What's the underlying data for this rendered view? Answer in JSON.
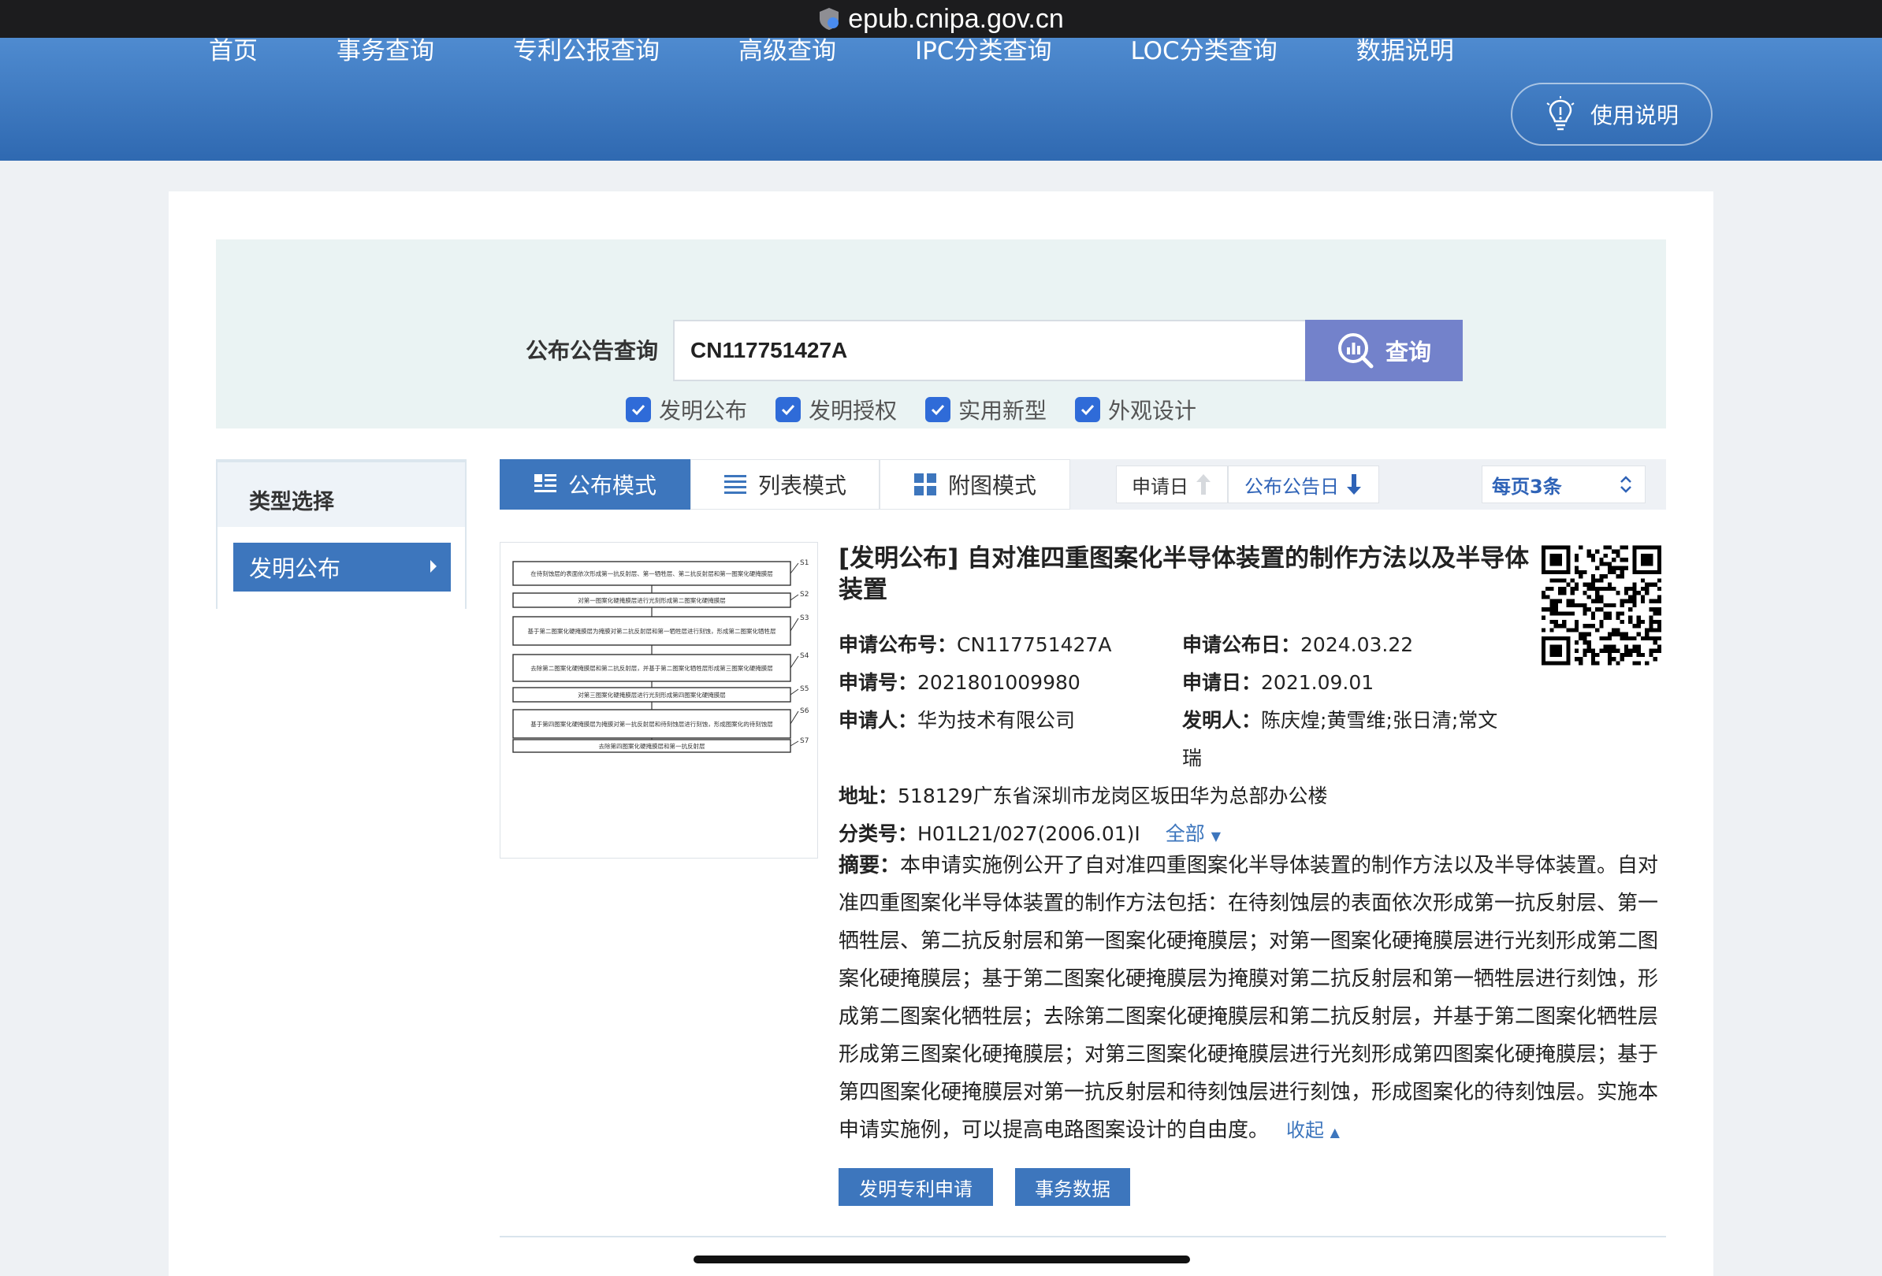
{
  "browser": {
    "url": "epub.cnipa.gov.cn"
  },
  "nav": {
    "items": [
      "首页",
      "事务查询",
      "专利公报查询",
      "高级查询",
      "IPC分类查询",
      "LOC分类查询",
      "数据说明"
    ],
    "help_label": "使用说明"
  },
  "search": {
    "label": "公布公告查询",
    "value": "CN117751427A",
    "button_label": "查询",
    "checkboxes": [
      {
        "label": "发明公布",
        "checked": true
      },
      {
        "label": "发明授权",
        "checked": true
      },
      {
        "label": "实用新型",
        "checked": true
      },
      {
        "label": "外观设计",
        "checked": true
      }
    ]
  },
  "sidebar": {
    "title": "类型选择",
    "items": [
      {
        "label": "发明公布",
        "selected": true
      }
    ]
  },
  "toolbar": {
    "modes": [
      {
        "label": "公布模式",
        "active": true,
        "icon": "list-detail-icon"
      },
      {
        "label": "列表模式",
        "active": false,
        "icon": "list-icon"
      },
      {
        "label": "附图模式",
        "active": false,
        "icon": "grid-icon"
      }
    ],
    "sort": [
      {
        "label": "申请日",
        "icon": "arrow-up-icon"
      },
      {
        "label": "公布公告日",
        "icon": "arrow-down-icon"
      }
    ],
    "per_page": "每页3条"
  },
  "result": {
    "title": "[发明公布] 自对准四重图案化半导体装置的制作方法以及半导体装置",
    "fields": {
      "pub_no_label": "申请公布号：",
      "pub_no": "CN117751427A",
      "pub_date_label": "申请公布日：",
      "pub_date": "2024.03.22",
      "app_no_label": "申请号：",
      "app_no": "2021801009980",
      "app_date_label": "申请日：",
      "app_date": "2021.09.01",
      "applicant_label": "申请人：",
      "applicant": "华为技术有限公司",
      "inventor_label": "发明人：",
      "inventor_line1": "陈庆煌;黄雪维;张日清;常文",
      "inventor_line2": "瑞",
      "address_label": "地址：",
      "address": "518129广东省深圳市龙岗区坂田华为总部办公楼",
      "class_label": "分类号：",
      "class": "H01L21/027(2006.01)I",
      "class_all": "全部"
    },
    "abstract_label": "摘要：",
    "abstract": "本申请实施例公开了自对准四重图案化半导体装置的制作方法以及半导体装置。自对准四重图案化半导体装置的制作方法包括：在待刻蚀层的表面依次形成第一抗反射层、第一牺牲层、第二抗反射层和第一图案化硬掩膜层；对第一图案化硬掩膜层进行光刻形成第二图案化硬掩膜层；基于第二图案化硬掩膜层为掩膜对第二抗反射层和第一牺牲层进行刻蚀，形成第二图案化牺牲层；去除第二图案化硬掩膜层和第二抗反射层，并基于第二图案化牺牲层形成第三图案化硬掩膜层；对第三图案化硬掩膜层进行光刻形成第四图案化硬掩膜层；基于第四图案化硬掩膜层对第一抗反射层和待刻蚀层进行刻蚀，形成图案化的待刻蚀层。实施本申请实施例，可以提高电路图案设计的自由度。",
    "collapse_label": "收起",
    "buttons": [
      "发明专利申请",
      "事务数据"
    ]
  },
  "flowchart": {
    "steps": [
      {
        "tag": "S1",
        "text": "在待刻蚀层的表面依次形成第一抗反射层、第一牺牲层、第二抗反射层和第一图案化硬掩膜层"
      },
      {
        "tag": "S2",
        "text": "对第一图案化硬掩膜层进行光刻形成第二图案化硬掩膜层"
      },
      {
        "tag": "S3",
        "text": "基于第二图案化硬掩膜层为掩膜对第二抗反射层和第一牺牲层进行刻蚀，形成第二图案化牺牲层"
      },
      {
        "tag": "S4",
        "text": "去除第二图案化硬掩膜层和第二抗反射层，并基于第二图案化牺牲层形成第三图案化硬掩膜层"
      },
      {
        "tag": "S5",
        "text": "对第三图案化硬掩膜层进行光刻形成第四图案化硬掩膜层"
      },
      {
        "tag": "S6",
        "text": "基于第四图案化硬掩膜层为掩膜对第一抗反射层和待刻蚀层进行刻蚀，形成图案化的待刻蚀层"
      },
      {
        "tag": "S7",
        "text": "去除第四图案化硬掩膜层和第一抗反射层"
      }
    ]
  },
  "colors": {
    "header": "#2f69b1",
    "accent": "#3d76bd",
    "search_btn": "#7382cb",
    "check": "#2f6bd8"
  }
}
